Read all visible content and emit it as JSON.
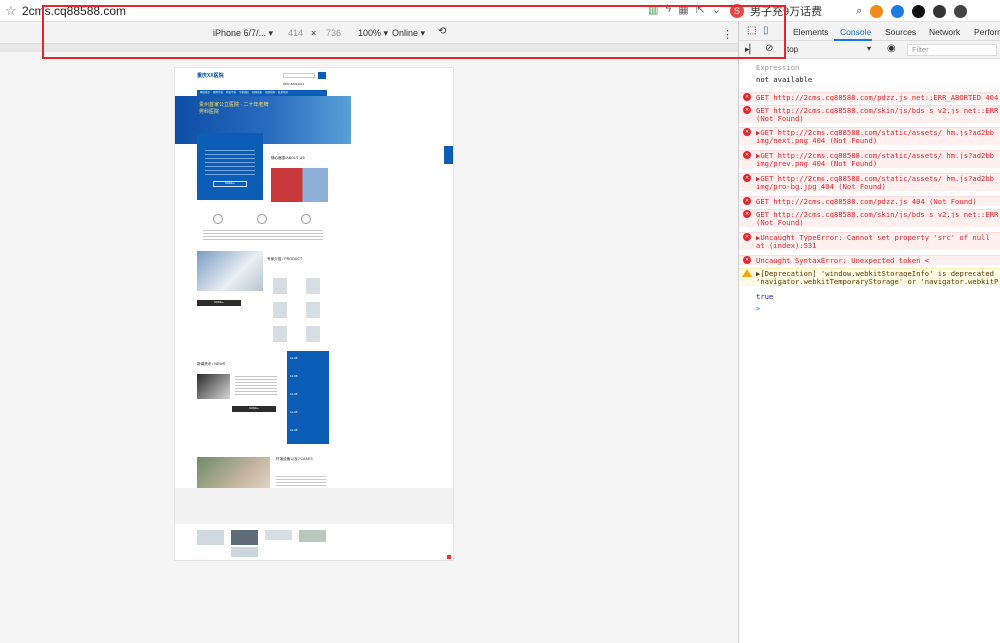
{
  "browser": {
    "url": "2cms.cq88588.com",
    "ext_label": "男子充9万话费"
  },
  "device_toolbar": {
    "device": "iPhone 6/7/...",
    "width": "414",
    "times": "×",
    "height": "736",
    "zoom": "100%",
    "network": "Online"
  },
  "devtools": {
    "tabs": [
      "Elements",
      "Console",
      "Sources",
      "Network",
      "Perform"
    ],
    "active_tab": "Console",
    "context": "top",
    "filter_placeholder": "Filter",
    "console": [
      {
        "type": "grey",
        "text": "Expression"
      },
      {
        "type": "plain",
        "text": "not available"
      },
      {
        "type": "error",
        "text": "GET http://2cms.cq88588.com/pdzz.js net::ERR_ABORTED 404"
      },
      {
        "type": "error",
        "text": "GET http://2cms.cq88588.com/skin/js/bds_s_v2.js net::ERR"
      },
      {
        "type": "error-cont",
        "text": "(Not Found)"
      },
      {
        "type": "error",
        "text": "▶GET http://2cms.cq88588.com/static/assets/ hm.js?ad2bb"
      },
      {
        "type": "error-cont",
        "text": "img/next.png 404 (Not Found)"
      },
      {
        "type": "error",
        "text": "▶GET http://2cms.cq88588.com/static/assets/ hm.js?ad2bb"
      },
      {
        "type": "error-cont",
        "text": "img/prev.png 404 (Not Found)"
      },
      {
        "type": "error",
        "text": "▶GET http://2cms.cq88588.com/static/assets/ hm.js?ad2bb"
      },
      {
        "type": "error-cont",
        "text": "img/pro-bg.jpg 404 (Not Found)"
      },
      {
        "type": "error",
        "text": "GET http://2cms.cq88588.com/pdzz.js 404 (Not Found)"
      },
      {
        "type": "error",
        "text": "GET http://2cms.cq88588.com/skin/js/bds_s_v2.js net::ERR"
      },
      {
        "type": "error-cont",
        "text": "(Not Found)"
      },
      {
        "type": "error",
        "text": "▶Uncaught TypeError: Cannot set property 'src' of null"
      },
      {
        "type": "error-cont",
        "text": "    at (index):531"
      },
      {
        "type": "error",
        "text": "Uncaught SyntaxError: Unexpected token <"
      },
      {
        "type": "warn",
        "text": "▶[Deprecation] 'window.webkitStorageInfo' is deprecated"
      },
      {
        "type": "warn-cont",
        "text": "'navigator.webkitTemporaryStorage' or 'navigator.webkitP"
      },
      {
        "type": "plain",
        "text": "true"
      },
      {
        "type": "prompt",
        "text": ">"
      }
    ]
  },
  "phone_page": {
    "logo_text": "重庆XX医院",
    "hotline": "0851-88033224",
    "nav": [
      "网站首页",
      "医院介绍",
      "特色专科",
      "专家团队",
      "新闻动态",
      "就医指南",
      "联系我们"
    ],
    "banner_text": "贵州首家公立医院 · 二十年老牌男科医院",
    "about_heading": "随心器皿/ABOUT US",
    "more": "MORE ▸",
    "product_heading": "专家介绍 / PRODUCT",
    "news_heading": "新闻资讯 / NEWS",
    "cases_heading": "环境设备以及 / CASES",
    "news_dates": [
      "11-08",
      "11-08",
      "11-08",
      "11-08",
      "11-08"
    ]
  }
}
